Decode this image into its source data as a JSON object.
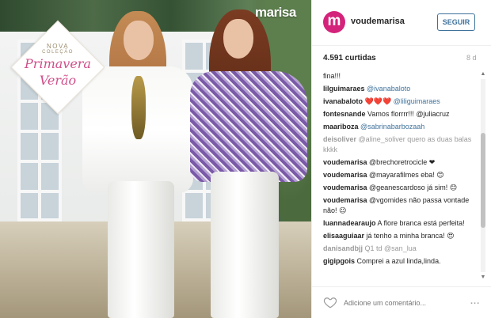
{
  "brand": "marisa",
  "badge": {
    "line1": "NOVA",
    "line2": "COLEÇÃO",
    "line3": "Primavera",
    "line4": "Verão"
  },
  "header": {
    "username": "voudemarisa",
    "avatar_letter": "m",
    "follow_label": "SEGUIR"
  },
  "stats": {
    "likes": "4.591 curtidas",
    "time": "8 d"
  },
  "comments": [
    {
      "user": "",
      "text": "fina!!!",
      "faded": false
    },
    {
      "user": "lilguimaraes",
      "text": "@ivanabaloto",
      "mention": true,
      "faded": false
    },
    {
      "user": "ivanabaloto",
      "text": "❤️❤️❤️ @liliguimaraes",
      "mention": true,
      "faded": false
    },
    {
      "user": "fontesnande",
      "text": "Vamos florrrr!!! @juliacruz",
      "faded": false
    },
    {
      "user": "maariboza",
      "text": "@sabrinabarbozaah",
      "mention": true,
      "faded": false
    },
    {
      "user": "deisoliver",
      "text": "@aline_soliver quero as duas balas kkkk",
      "faded": true
    },
    {
      "user": "voudemarisa",
      "text": "@brechoretrocicle ❤",
      "faded": false
    },
    {
      "user": "voudemarisa",
      "text": "@mayarafilmes eba! 😊",
      "faded": false
    },
    {
      "user": "voudemarisa",
      "text": "@geanescardoso já sim! 😊",
      "faded": false
    },
    {
      "user": "voudemarisa",
      "text": "@vgomides não passa vontade não! 😉",
      "faded": false
    },
    {
      "user": "luannadearaujo",
      "text": "A flore branca está perfeita!",
      "faded": false
    },
    {
      "user": "elisaaguiaar",
      "text": "já tenho a minha branca! 😍",
      "faded": false
    },
    {
      "user": "danisandbjj",
      "text": "Q1 td @san_lua",
      "faded": true
    },
    {
      "user": "gigipgois",
      "text": "Comprei a azul linda,linda.",
      "faded": false
    }
  ],
  "footer": {
    "placeholder": "Adicione um comentário...",
    "more": "..."
  },
  "colors": {
    "accent": "#3f729b",
    "brand_pink": "#d4237a"
  }
}
